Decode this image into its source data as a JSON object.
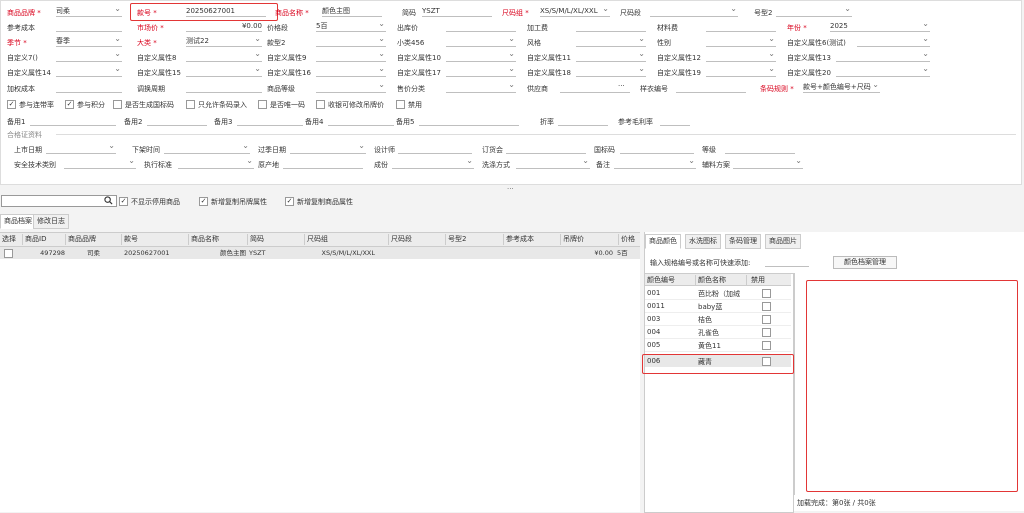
{
  "form": {
    "row1": {
      "brand_label": "商品品牌",
      "brand_value": "司柔",
      "style_no_label": "款号",
      "style_no_value": "20250627001",
      "name_label": "商品名称",
      "name_value": "颜色主图",
      "short_label": "简码",
      "short_value": "YSZT",
      "sizegroup_label": "尺码组",
      "sizegroup_value": "XS/S/M/L/XL/XXL",
      "sizerange_label": "尺码段",
      "model_label": "号型2"
    },
    "row2": {
      "cost_label": "参考成本",
      "market_label": "市场价",
      "market_value": "¥0.00",
      "pricerange_label": "价格段",
      "pricerange_value": "5百",
      "outprice_label": "出库价",
      "process_label": "加工费",
      "material_label": "材料费",
      "year_label": "年份",
      "year_value": "2025"
    },
    "row3": {
      "season_label": "季节",
      "season_value": "春季",
      "category_label": "大类",
      "category_value": "测试22",
      "type_label": "款型2",
      "subcat_label": "小类456",
      "style_label": "风格",
      "gender_label": "性别",
      "custom6_label": "自定义属性6(测试)"
    },
    "row4": {
      "c7": "自定义7()",
      "c8": "自定义属性8",
      "c9": "自定义属性9",
      "c10": "自定义属性10",
      "c11": "自定义属性11",
      "c12": "自定义属性12",
      "c13": "自定义属性13"
    },
    "row5": {
      "c14": "自定义属性14",
      "c15": "自定义属性15",
      "c16": "自定义属性16",
      "c17": "自定义属性17",
      "c18": "自定义属性18",
      "c19": "自定义属性19",
      "c20": "自定义属性20"
    },
    "row6": {
      "addcost_label": "加权成本",
      "swap_label": "调换周期",
      "grade_label": "商品等级",
      "shares_label": "售价分类",
      "supplier_label": "供应商",
      "sample_label": "样衣编号",
      "barcode_rule_label": "条码规则",
      "barcode_rule_value": "款号+颜色编号+尺码"
    },
    "checks": [
      {
        "label": "参与连带率",
        "checked": "✓"
      },
      {
        "label": "参与积分",
        "checked": "✓"
      },
      {
        "label": "是否生成国标码",
        "checked": ""
      },
      {
        "label": "只允许条码录入",
        "checked": ""
      },
      {
        "label": "是否唯一码",
        "checked": ""
      },
      {
        "label": "收银可修改吊牌价",
        "checked": ""
      },
      {
        "label": "禁用",
        "checked": ""
      }
    ],
    "row8": {
      "note1": "备用1",
      "note2": "备用2",
      "note3": "备用3",
      "note4": "备用4",
      "note5": "备用5",
      "discount": "折率",
      "gross": "参考毛利率"
    },
    "cert_section": "合格证资料",
    "cert1": {
      "launch": "上市日期",
      "offshelf": "下架时间",
      "expiry": "过季日期",
      "designer": "设计师",
      "order": "订货会",
      "gbcode": "国标码",
      "level": "等级"
    },
    "cert2": {
      "safety": "安全技术类别",
      "standard": "执行标准",
      "origin": "原产地",
      "composition": "成份",
      "wash": "洗涤方式",
      "remark": "备注",
      "accessories": "辅料方案"
    }
  },
  "toolbar": {
    "hide_disabled": "不显示停用商品",
    "copy_tag": "新增复制吊牌属性",
    "copy_goods": "新增复制商品属性"
  },
  "left_tabs": [
    "商品档案",
    "修改日志"
  ],
  "table": {
    "headers": [
      "选择",
      "商品ID",
      "商品品牌",
      "款号",
      "商品名称",
      "简码",
      "尺码组",
      "尺码段",
      "号型2",
      "参考成本",
      "吊牌价",
      "价格"
    ],
    "row": {
      "id": "497298",
      "brand": "司柔",
      "style": "20250627001",
      "name": "颜色主图",
      "short": "YSZT",
      "sizegroup": "XS/S/M/L/XL/XXL",
      "tag_price": "¥0.00",
      "price": "5百"
    }
  },
  "right_tabs": [
    "商品颜色",
    "水洗图标",
    "条码管理",
    "商品图片"
  ],
  "color_panel": {
    "quick_add_label": "输入规格编号或名称可快速添加:",
    "manage_button": "颜色档案管理",
    "headers": [
      "颜色编号",
      "颜色名称",
      "禁用"
    ],
    "rows": [
      {
        "code": "001",
        "name": "芭比粉（加绒"
      },
      {
        "code": "0011",
        "name": "baby蓝"
      },
      {
        "code": "003",
        "name": "桔色"
      },
      {
        "code": "004",
        "name": "孔雀色"
      },
      {
        "code": "005",
        "name": "黄色11"
      },
      {
        "code": "006",
        "name": "藏青"
      }
    ],
    "load_status": "加载完成：第0张 / 共0张"
  }
}
